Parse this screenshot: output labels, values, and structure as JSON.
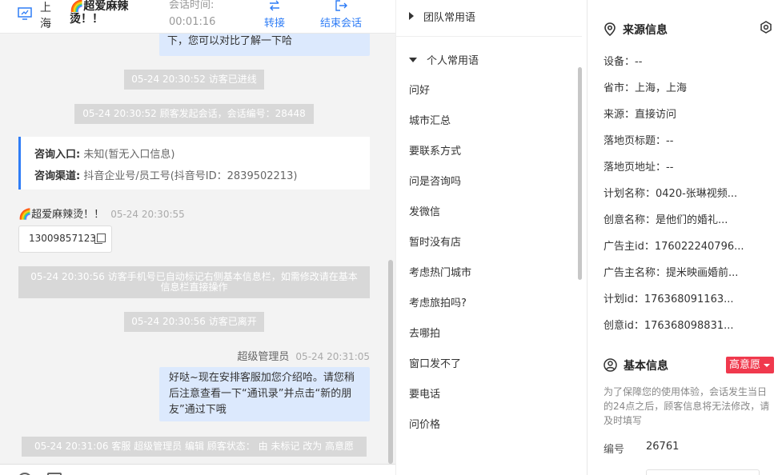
{
  "header": {
    "city": "上海",
    "customer_name": "🌈超爱麻辣烫！！",
    "timer_label": "会话时间:",
    "timer_value": "00:01:16",
    "transfer_label": "转接",
    "end_label": "结束会话"
  },
  "chat": {
    "agent_bubble_1_tail": "下，您可以对比了解一下哈",
    "sys_visitor_entered": "05-24 20:30:52 访客已进线",
    "sys_session_started": "05-24 20:30:52 顾客发起会话，会话编号：28448",
    "info_card": {
      "entry_label": "咨询入口:",
      "entry_value": "未知(暂无入口信息)",
      "channel_label": "咨询渠道:",
      "channel_value": "抖音企业号/员工号(抖音号ID：2839502213)"
    },
    "visitor_name": "🌈超爱麻辣烫！！",
    "visitor_time": "05-24 20:30:55",
    "visitor_phone": "13009857123",
    "sys_phone_marked": "05-24 20:30:56 访客手机号已自动标记右侧基本信息栏，如需修改请在基本信息栏直接操作",
    "sys_visitor_left": "05-24 20:30:56 访客已离开",
    "agent_name": "超级管理员",
    "agent_time": "05-24 20:31:05",
    "agent_bubble_2": "好哒~现在安排客服加您介绍哈。请您稍后注意查看一下“通讯录”并点击“新的朋友”通过下哦",
    "sys_status_changed": "05-24 20:31:06 客服 超级管理员 编辑 顾客状态： 由 未标记 改为 高意愿"
  },
  "phrases": {
    "team_group": "团队常用语",
    "personal_group": "个人常用语",
    "items": [
      "问好",
      "城市汇总",
      "要联系方式",
      "问是咨询吗",
      "发微信",
      "暂时没有店",
      "考虑热门城市",
      "考虑旅拍吗?",
      "去哪拍",
      "窗口发不了",
      "要电话",
      "问价格"
    ]
  },
  "source_info": {
    "title": "来源信息",
    "rows": [
      "设备：--",
      "省市：上海，上海",
      "来源：直接访问",
      "落地页标题：--",
      "落地页地址：--",
      "计划名称：0420-张琳视频...",
      "创意名称：是他们的婚礼...",
      "广告主id：176022240796...",
      "广告主名称：提米映画婚前...",
      "计划id：176368091163...",
      "创意id：176368098831..."
    ]
  },
  "basic_info": {
    "title": "基本信息",
    "intent_badge": "高意愿",
    "hint": "为了保障您的使用体验，会话发生当日的24点之后，顾客信息将无法修改，请及时填写",
    "id_label": "编号",
    "id_value": "26761"
  },
  "colors": {
    "accent": "#2f7df6",
    "agent_bubble": "#dce9fd",
    "system_note": "#d8d8d8",
    "intent_badge": "#f0394d",
    "chat_bg": "#f3f3f3"
  }
}
